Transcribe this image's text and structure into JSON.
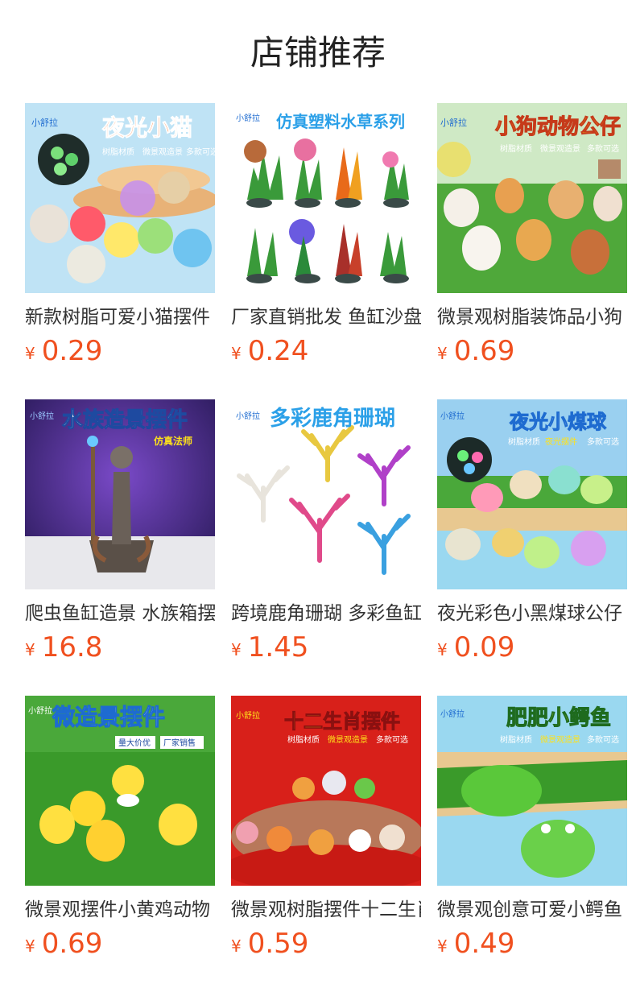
{
  "page_title": "店铺推荐",
  "currency_symbol": "¥",
  "brand_logo_text": "小舒拉",
  "products": [
    {
      "name": "新款树脂可爱小猫摆件",
      "price": "0.29",
      "banner": "夜光小猫",
      "tagline": [
        "树脂材质",
        "微景观造景",
        "多款可选"
      ],
      "icon": "glow-cat-figurines-image"
    },
    {
      "name": "厂家直销批发 鱼缸沙盘",
      "price": "0.24",
      "banner": "仿真塑料水草系列",
      "tagline": [],
      "icon": "artificial-aquarium-plants-image"
    },
    {
      "name": "微景观树脂装饰品小狗",
      "price": "0.69",
      "banner": "小狗动物公仔",
      "tagline": [
        "树脂材质",
        "微景观造景",
        "多款可选"
      ],
      "icon": "puppy-figurines-image"
    },
    {
      "name": "爬虫鱼缸造景 水族箱摆件",
      "price": "16.8",
      "banner": "水族造景摆件",
      "tagline": [
        "仿真法师"
      ],
      "icon": "wizard-statue-image"
    },
    {
      "name": "跨境鹿角珊瑚 多彩鱼缸",
      "price": "1.45",
      "banner": "多彩鹿角珊瑚",
      "tagline": [],
      "icon": "coral-ornaments-image"
    },
    {
      "name": "夜光彩色小黑煤球公仔",
      "price": "0.09",
      "banner": "夜光小煤球",
      "tagline": [
        "树脂材质",
        "夜光摆件",
        "多款可选"
      ],
      "icon": "glow-soot-sprite-image"
    },
    {
      "name": "微景观摆件小黄鸡动物",
      "price": "0.69",
      "banner": "微造景摆件",
      "tagline": [
        "量大价优",
        "厂家销售"
      ],
      "icon": "yellow-chick-figurines-image"
    },
    {
      "name": "微景观树脂摆件十二生肖",
      "price": "0.59",
      "banner": "十二生肖摆件",
      "tagline": [
        "树脂材质",
        "微景观造景",
        "多款可选"
      ],
      "icon": "zodiac-figurines-image"
    },
    {
      "name": "微景观创意可爱小鳄鱼",
      "price": "0.49",
      "banner": "肥肥小鳄鱼",
      "tagline": [
        "树脂材质",
        "微景观造景",
        "多款可选"
      ],
      "icon": "crocodile-figurines-image"
    }
  ],
  "colors": {
    "price": "#f0501f",
    "text": "#333333",
    "title": "#222222"
  }
}
